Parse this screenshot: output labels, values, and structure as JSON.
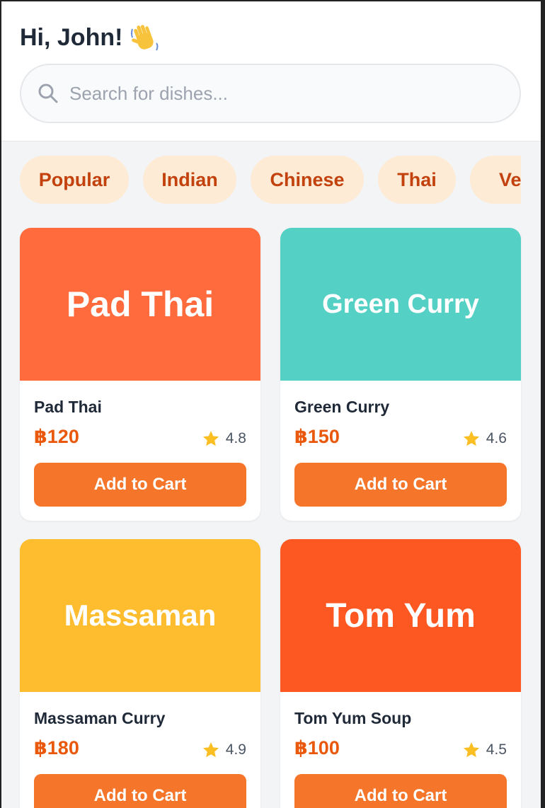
{
  "header": {
    "greeting": "Hi, John!",
    "wave_icon": "waving-hand-icon"
  },
  "search": {
    "placeholder": "Search for dishes...",
    "value": "",
    "icon": "search-icon"
  },
  "categories": [
    "Popular",
    "Indian",
    "Chinese",
    "Thai",
    "Veg"
  ],
  "colors": {
    "accent": "#f5762b",
    "price": "#ea580c",
    "chip_bg": "#fdebd6",
    "chip_text": "#c2410c",
    "star": "#fbbf24"
  },
  "dishes": [
    {
      "image_text": "Pad Thai",
      "name": "Pad Thai",
      "price": "฿120",
      "rating": "4.8",
      "button": "Add to Cart",
      "color": "#ff6b3d"
    },
    {
      "image_text": "Green Curry",
      "name": "Green Curry",
      "price": "฿150",
      "rating": "4.6",
      "button": "Add to Cart",
      "color": "#55d0c5"
    },
    {
      "image_text": "Massaman",
      "name": "Massaman Curry",
      "price": "฿180",
      "rating": "4.9",
      "button": "Add to Cart",
      "color": "#fdbd2e"
    },
    {
      "image_text": "Tom Yum",
      "name": "Tom Yum Soup",
      "price": "฿100",
      "rating": "4.5",
      "button": "Add to Cart",
      "color": "#fd5722"
    }
  ]
}
